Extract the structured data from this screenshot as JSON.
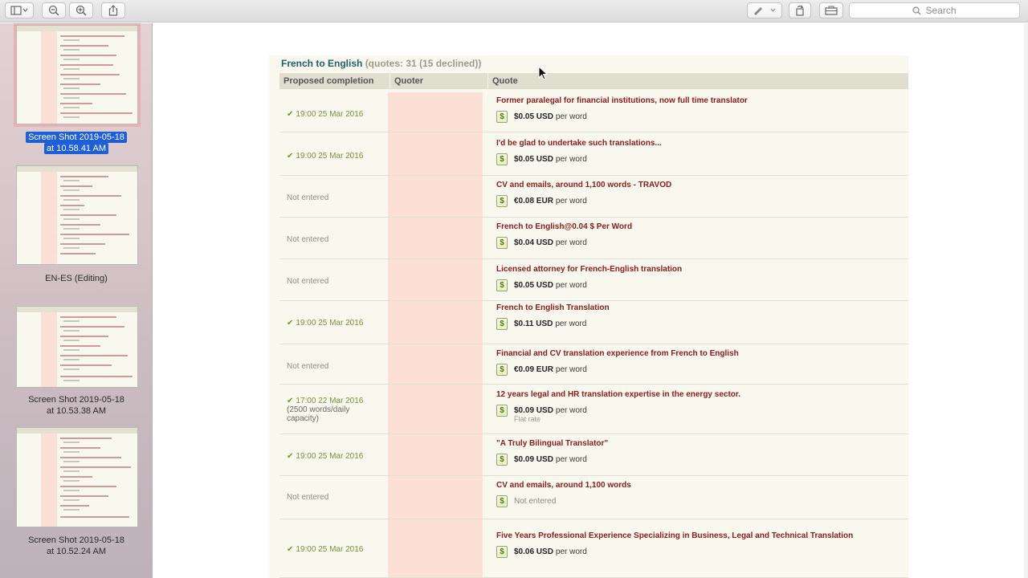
{
  "toolbar": {
    "search_placeholder": "Search",
    "icons": [
      "sidebar-icon",
      "zoom-out-icon",
      "zoom-in-icon",
      "share-icon",
      "markup-pen-icon",
      "rotate-icon",
      "toolbox-icon"
    ]
  },
  "sidebar": {
    "items": [
      {
        "caption_line1": "Screen Shot 2019-05-18",
        "caption_line2": "at 10.58.41 AM",
        "selected": true
      },
      {
        "caption_line1": "EN-ES (Editing)",
        "caption_line2": "",
        "selected": false
      },
      {
        "caption_line1": "Screen Shot 2019-05-18",
        "caption_line2": "at 10.53.38 AM",
        "selected": false
      },
      {
        "caption_line1": "Screen Shot 2019-05-18",
        "caption_line2": "at 10.52.24 AM",
        "selected": false
      }
    ]
  },
  "document": {
    "title": "French to English",
    "subtitle": "(quotes: 31 (15 declined))",
    "columns": [
      "Proposed completion",
      "Quoter",
      "Quote"
    ],
    "rows": [
      {
        "completion": "19:00 25 Mar 2016",
        "note": "",
        "title": "Former paralegal for financial institutions, now full time translator",
        "price": "$0.05 USD",
        "unit": "per word",
        "flat": ""
      },
      {
        "completion": "19:00 25 Mar 2016",
        "note": "",
        "title": "I'd be glad to undertake such translations...",
        "price": "$0.05 USD",
        "unit": "per word",
        "flat": ""
      },
      {
        "completion": "Not entered",
        "note": "",
        "title": "CV and emails, around 1,100 words - TRAVOD",
        "price": "€0.08 EUR",
        "unit": "per word",
        "flat": ""
      },
      {
        "completion": "Not entered",
        "note": "",
        "title": "French to English@0.04 $ Per Word",
        "price": "$0.04 USD",
        "unit": "per word",
        "flat": ""
      },
      {
        "completion": "Not entered",
        "note": "",
        "title": "Licensed attorney for French-English translation",
        "price": "$0.05 USD",
        "unit": "per word",
        "flat": ""
      },
      {
        "completion": "19:00 25 Mar 2016",
        "note": "",
        "title": "French to English Translation",
        "price": "$0.11 USD",
        "unit": "per word",
        "flat": ""
      },
      {
        "completion": "Not entered",
        "note": "",
        "title": "Financial and CV translation experience from French to English",
        "price": "€0.09 EUR",
        "unit": "per word",
        "flat": ""
      },
      {
        "completion": "17:00 22 Mar 2016",
        "note": "(2500 words/daily capacity)",
        "title": "12 years legal and HR translation expertise in the energy sector.",
        "price": "$0.09 USD",
        "unit": "per word",
        "flat": "Flat rate"
      },
      {
        "completion": "19:00 25 Mar 2016",
        "note": "",
        "title": "\"A Truly Bilingual Translator\"",
        "price": "$0.09 USD",
        "unit": "per word",
        "flat": ""
      },
      {
        "completion": "Not entered",
        "note": "",
        "title": "CV and emails, around 1,100 words",
        "price": "",
        "unit": "Not entered",
        "flat": ""
      },
      {
        "completion": "19:00 25 Mar 2016",
        "note": "",
        "title": "Five Years Professional Experience Specializing in Business, Legal and Technical Translation",
        "price": "$0.06 USD",
        "unit": "per word",
        "flat": ""
      }
    ]
  }
}
